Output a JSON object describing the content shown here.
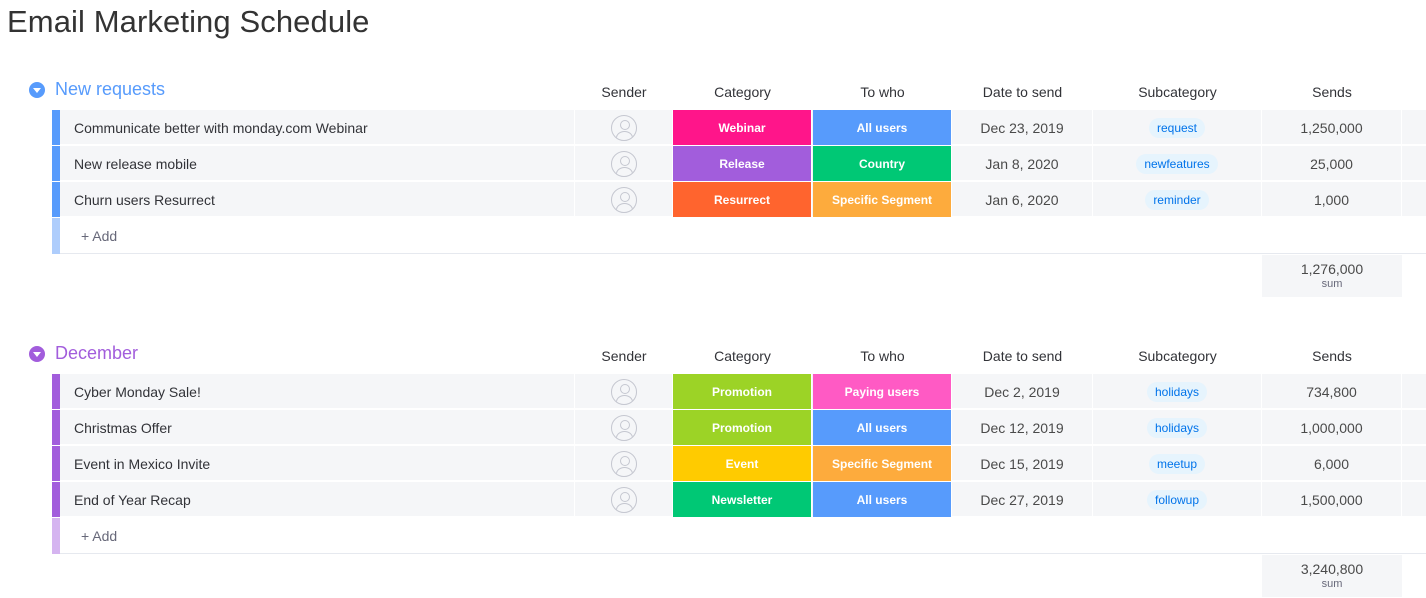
{
  "page": {
    "title": "Email Marketing Schedule"
  },
  "columns": {
    "sender": "Sender",
    "category": "Category",
    "to_who": "To who",
    "date": "Date to send",
    "subcategory": "Subcategory",
    "sends": "Sends"
  },
  "colors": {
    "new_requests": "#579bfc",
    "december": "#a25ddc",
    "webinar": "#ff158a",
    "release": "#a25ddc",
    "resurrect": "#ff642e",
    "promotion": "#9cd326",
    "event": "#ffcb00",
    "newsletter": "#00c875",
    "all_users": "#579bfc",
    "country": "#00c875",
    "specific_segment": "#fdab3d",
    "paying_users": "#ff5ac4"
  },
  "groups": [
    {
      "title": "New requests",
      "rows": [
        {
          "name": "Communicate better with monday.com Webinar",
          "category": "Webinar",
          "to_who": "All users",
          "date": "Dec 23, 2019",
          "subcategory": "request",
          "sends": "1,250,000"
        },
        {
          "name": "New release mobile",
          "category": "Release",
          "to_who": "Country",
          "date": "Jan 8, 2020",
          "subcategory": "newfeatures",
          "sends": "25,000"
        },
        {
          "name": "Churn users Resurrect",
          "category": "Resurrect",
          "to_who": "Specific Segment",
          "date": "Jan 6, 2020",
          "subcategory": "reminder",
          "sends": "1,000"
        }
      ],
      "add_label": "+ Add",
      "sum_value": "1,276,000",
      "sum_label": "sum"
    },
    {
      "title": "December",
      "rows": [
        {
          "name": "Cyber Monday Sale!",
          "category": "Promotion",
          "to_who": "Paying users",
          "date": "Dec 2, 2019",
          "subcategory": "holidays",
          "sends": "734,800"
        },
        {
          "name": "Christmas Offer",
          "category": "Promotion",
          "to_who": "All users",
          "date": "Dec 12, 2019",
          "subcategory": "holidays",
          "sends": "1,000,000"
        },
        {
          "name": "Event in Mexico Invite",
          "category": "Event",
          "to_who": "Specific Segment",
          "date": "Dec 15, 2019",
          "subcategory": "meetup",
          "sends": "6,000"
        },
        {
          "name": "End of Year Recap",
          "category": "Newsletter",
          "to_who": "All users",
          "date": "Dec 27, 2019",
          "subcategory": "followup",
          "sends": "1,500,000"
        }
      ],
      "add_label": "+ Add",
      "sum_value": "3,240,800",
      "sum_label": "sum"
    }
  ]
}
